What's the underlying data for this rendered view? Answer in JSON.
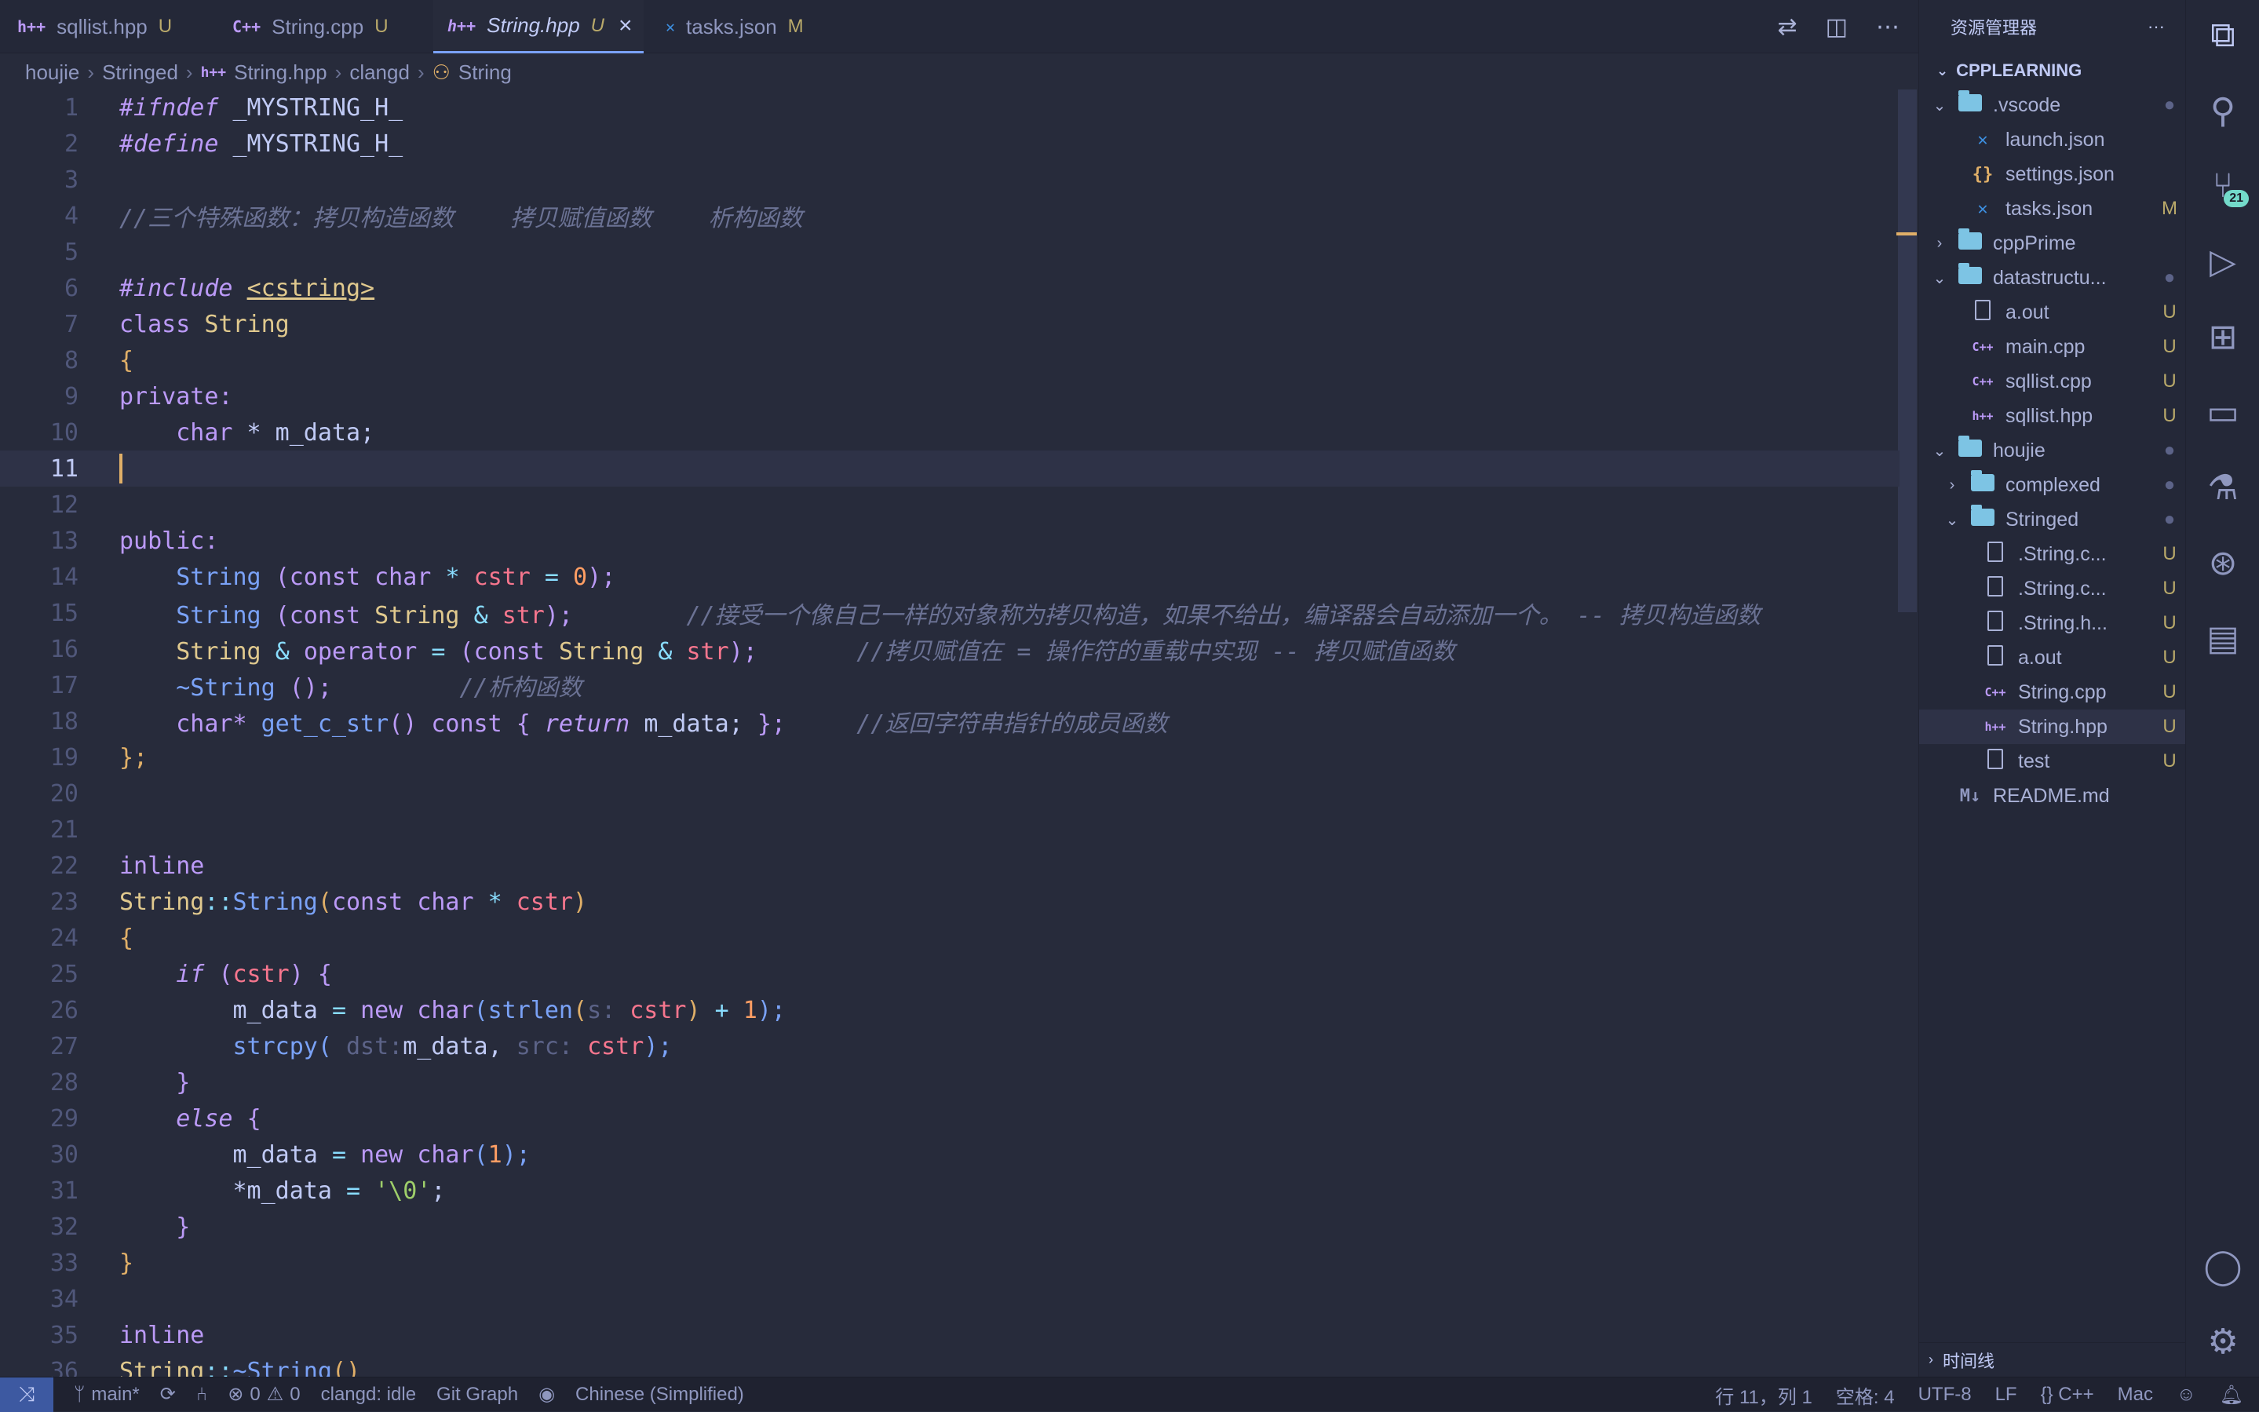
{
  "tabs": [
    {
      "icon": "h++",
      "label": "sqllist.hpp",
      "badge": "U"
    },
    {
      "icon": "C++",
      "label": "String.cpp",
      "badge": "U"
    },
    {
      "icon": "h++",
      "label": "String.hpp",
      "badge": "U",
      "active": true,
      "close": "×"
    },
    {
      "icon": "json",
      "label": "tasks.json",
      "badge": "M"
    }
  ],
  "breadcrumb": [
    "houjie",
    "Stringed",
    "String.hpp",
    "clangd",
    "String"
  ],
  "current_line": 11,
  "code": {
    "l1": [
      "#ifndef",
      " _MYSTRING_H_"
    ],
    "l2": [
      "#define",
      " _MYSTRING_H_"
    ],
    "l4": "//三个特殊函数：拷贝构造函数    拷贝赋值函数    析构函数",
    "l6": [
      "#include",
      "<cstring>"
    ],
    "l7": [
      "class",
      "String"
    ],
    "l8": "{",
    "l9": "private:",
    "l10": [
      "char",
      " * m_data;"
    ],
    "l13": "public:",
    "l14": [
      "String",
      "(",
      "const",
      "char",
      "*",
      "cstr",
      "=",
      "0",
      ");"
    ],
    "l15": [
      "String",
      "(",
      "const",
      "String",
      "&",
      "str",
      ");",
      "//接受一个像自己一样的对象称为拷贝构造，如果不给出，编译器会自动添加一个。 -- 拷贝构造函数"
    ],
    "l16": [
      "String",
      "&",
      "operator",
      "=",
      "(",
      "const",
      "String",
      "&",
      "str",
      ");",
      "//拷贝赋值在 = 操作符的重载中实现 -- 拷贝赋值函数"
    ],
    "l17": [
      "~String",
      "();",
      "//析构函数"
    ],
    "l18": [
      "char*",
      "get_c_str",
      "()",
      "const",
      "{",
      "return",
      "m_data;",
      "};",
      "//返回字符串指针的成员函数"
    ],
    "l19": "};",
    "l22": "inline",
    "l23": [
      "String",
      "::",
      "String",
      "(",
      "const",
      "char",
      "*",
      "cstr",
      ")"
    ],
    "l24": "{",
    "l25": [
      "if",
      "(",
      "cstr",
      ")",
      "{"
    ],
    "l26": [
      "m_data",
      "=",
      "new",
      "char",
      "(",
      "strlen",
      "(",
      "s:",
      "cstr",
      ")",
      "+",
      "1",
      ");"
    ],
    "l27": [
      "strcpy",
      "(",
      "dst:",
      "m_data,",
      "src:",
      "cstr",
      ");"
    ],
    "l28": "}",
    "l29": [
      "else",
      "{"
    ],
    "l30": [
      "m_data",
      "=",
      "new",
      "char",
      "(",
      "1",
      ");"
    ],
    "l31": [
      "*m_data",
      "=",
      "'\\0'",
      ";"
    ],
    "l32": "}",
    "l33": "}",
    "l35": "inline",
    "l36": [
      "String",
      "::",
      "~String",
      "()"
    ]
  },
  "explorer": {
    "title": "资源管理器",
    "more": "···",
    "root": "CPPLEARNING",
    "items": [
      {
        "depth": 1,
        "chevron": "⌄",
        "kind": "folder",
        "name": ".vscode",
        "status": "●"
      },
      {
        "depth": 2,
        "kind": "vscode",
        "name": "launch.json",
        "status": ""
      },
      {
        "depth": 2,
        "kind": "json",
        "name": "settings.json",
        "status": ""
      },
      {
        "depth": 2,
        "kind": "vscode",
        "name": "tasks.json",
        "status": "M"
      },
      {
        "depth": 1,
        "chevron": "›",
        "kind": "folder",
        "name": "cppPrime",
        "status": ""
      },
      {
        "depth": 1,
        "chevron": "⌄",
        "kind": "folder",
        "name": "datastructu...",
        "status": "●"
      },
      {
        "depth": 2,
        "kind": "file",
        "name": "a.out",
        "status": "U"
      },
      {
        "depth": 2,
        "kind": "cpp",
        "name": "main.cpp",
        "status": "U"
      },
      {
        "depth": 2,
        "kind": "cpp",
        "name": "sqllist.cpp",
        "status": "U"
      },
      {
        "depth": 2,
        "kind": "hpp",
        "name": "sqllist.hpp",
        "status": "U"
      },
      {
        "depth": 1,
        "chevron": "⌄",
        "kind": "folder",
        "name": "houjie",
        "status": "●"
      },
      {
        "depth": 2,
        "chevron": "›",
        "kind": "folder",
        "name": "complexed",
        "status": "●"
      },
      {
        "depth": 2,
        "chevron": "⌄",
        "kind": "folder",
        "name": "Stringed",
        "status": "●"
      },
      {
        "depth": 3,
        "kind": "file",
        "name": ".String.c...",
        "status": "U"
      },
      {
        "depth": 3,
        "kind": "file",
        "name": ".String.c...",
        "status": "U"
      },
      {
        "depth": 3,
        "kind": "file",
        "name": ".String.h...",
        "status": "U"
      },
      {
        "depth": 3,
        "kind": "file",
        "name": "a.out",
        "status": "U"
      },
      {
        "depth": 3,
        "kind": "cpp",
        "name": "String.cpp",
        "status": "U"
      },
      {
        "depth": 3,
        "kind": "hpp",
        "name": "String.hpp",
        "status": "U",
        "selected": true
      },
      {
        "depth": 3,
        "kind": "file",
        "name": "test",
        "status": "U"
      },
      {
        "depth": 1,
        "kind": "md",
        "name": "README.md",
        "status": ""
      }
    ],
    "timeline": "时间线"
  },
  "activity": {
    "scm_badge": "21"
  },
  "status": {
    "branch": "main*",
    "errors": "0",
    "warnings": "0",
    "clangd": "clangd: idle",
    "gitgraph": "Git Graph",
    "language_pack": "Chinese (Simplified)",
    "position": "行 11，列 1",
    "spaces": "空格: 4",
    "encoding": "UTF-8",
    "eol": "LF",
    "language": "C++",
    "keymap": "Mac"
  },
  "colors": {
    "accent": "#7aa2f7",
    "cursor": "#e0af68",
    "scm_badge": "#73daca"
  }
}
